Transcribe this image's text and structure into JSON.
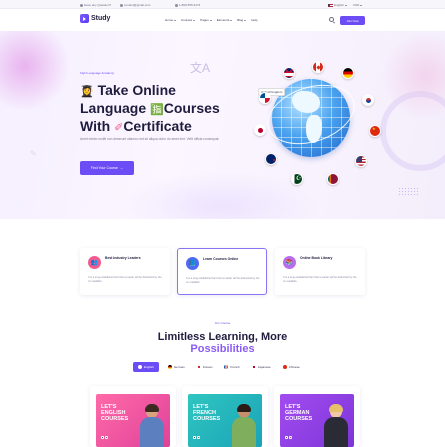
{
  "topbar": {
    "address": "Have any Question?",
    "email": "contact@gmail.com",
    "phone": "1-800-555-5174",
    "language": "English",
    "currency": "USD"
  },
  "header": {
    "logo_text": "Study",
    "nav": [
      "Home",
      "Courses",
      "Pages",
      "Elements",
      "Blog",
      "Help"
    ],
    "join_label": "Join Now"
  },
  "hero": {
    "eyebrow": "Fight Language Academy",
    "title_line1": "Take Online",
    "title_line2a": "Language",
    "title_line2b": "Courses",
    "title_line3a": "With",
    "title_line3b": "Certificate",
    "description": "Amet minim mollit non deserunt ullamco est sit aliqua dolor do amet sint. Velit officia consequat.",
    "cta_label": "Find Your Course",
    "globe_tag": "United Kingdom"
  },
  "features": [
    {
      "title": "Best Industry Leaders",
      "desc": "It is a long established fact that a reader will be distracted by the on readable.",
      "color": "#ef5c8f",
      "icon": "users-icon"
    },
    {
      "title": "Learn Courses Online",
      "desc": "It is a long established fact that a reader will be distracted by the on readable.",
      "color": "#4f6bf5",
      "icon": "book-icon"
    },
    {
      "title": "Online Book Library",
      "desc": "It is a long established fact that a reader will be distracted by the on readable.",
      "color": "#b86cf0",
      "icon": "library-icon"
    }
  ],
  "section": {
    "eyebrow": "Our Course",
    "title": "Limitless Learning, More",
    "title_highlight": "Possibilities"
  },
  "filters": [
    {
      "label": "English",
      "color": "#6c4cf5"
    },
    {
      "label": "German",
      "color": "#dd0000"
    },
    {
      "label": "Korean",
      "color": "#0047a0"
    },
    {
      "label": "French",
      "color": "#0055a4"
    },
    {
      "label": "Japanese",
      "color": "#bc002d"
    },
    {
      "label": "Chinese",
      "color": "#de2910"
    }
  ],
  "courses": [
    {
      "line1": "LET'S",
      "line2": "ENGLISH",
      "line3": "COURSES"
    },
    {
      "line1": "LET'S",
      "line2": "FRENCH",
      "line3": "COURSES"
    },
    {
      "line1": "LET'S",
      "line2": "GERMAN",
      "line3": "COURSES"
    }
  ]
}
